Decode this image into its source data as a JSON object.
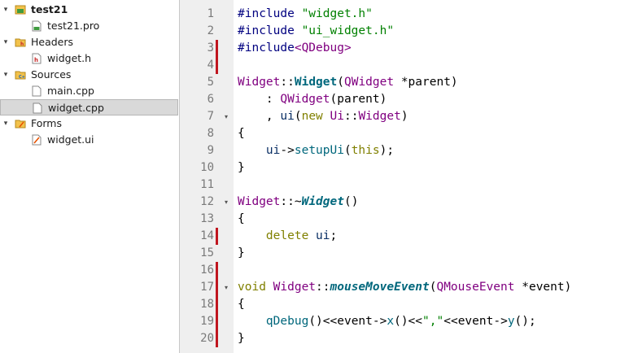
{
  "project_tree": [
    {
      "label": "test21",
      "depth": 0,
      "arrow": "down",
      "icon": "project-icon",
      "bold": true
    },
    {
      "label": "test21.pro",
      "depth": 1,
      "arrow": "",
      "icon": "pro-file-icon"
    },
    {
      "label": "Headers",
      "depth": 0,
      "arrow": "down",
      "icon": "headers-folder-icon"
    },
    {
      "label": "widget.h",
      "depth": 1,
      "arrow": "",
      "icon": "header-file-icon"
    },
    {
      "label": "Sources",
      "depth": 0,
      "arrow": "down",
      "icon": "sources-folder-icon"
    },
    {
      "label": "main.cpp",
      "depth": 1,
      "arrow": "",
      "icon": "cpp-file-icon"
    },
    {
      "label": "widget.cpp",
      "depth": 1,
      "arrow": "",
      "icon": "cpp-file-icon",
      "selected": true
    },
    {
      "label": "Forms",
      "depth": 0,
      "arrow": "down",
      "icon": "forms-folder-icon"
    },
    {
      "label": "widget.ui",
      "depth": 1,
      "arrow": "",
      "icon": "ui-file-icon"
    }
  ],
  "editor": {
    "lines": [
      {
        "n": "1",
        "changed": false,
        "fold": false,
        "tokens": [
          {
            "t": "#include ",
            "c": "pp"
          },
          {
            "t": "\"widget.h\"",
            "c": "str"
          }
        ]
      },
      {
        "n": "2",
        "changed": false,
        "fold": false,
        "tokens": [
          {
            "t": "#include ",
            "c": "pp"
          },
          {
            "t": "\"ui_widget.h\"",
            "c": "str"
          }
        ]
      },
      {
        "n": "3",
        "changed": true,
        "fold": false,
        "tokens": [
          {
            "t": "#include",
            "c": "pp"
          },
          {
            "t": "<QDebug>",
            "c": "type"
          }
        ]
      },
      {
        "n": "4",
        "changed": true,
        "fold": false,
        "tokens": []
      },
      {
        "n": "5",
        "changed": false,
        "fold": false,
        "tokens": [
          {
            "t": "Widget",
            "c": "type"
          },
          {
            "t": "::",
            "c": "pl"
          },
          {
            "t": "Widget",
            "c": "fnb"
          },
          {
            "t": "(",
            "c": "pl"
          },
          {
            "t": "QWidget",
            "c": "type"
          },
          {
            "t": " *parent)",
            "c": "pl"
          }
        ]
      },
      {
        "n": "6",
        "changed": false,
        "fold": false,
        "tokens": [
          {
            "t": "    : ",
            "c": "pl"
          },
          {
            "t": "QWidget",
            "c": "type"
          },
          {
            "t": "(parent)",
            "c": "pl"
          }
        ]
      },
      {
        "n": "7",
        "changed": false,
        "fold": true,
        "tokens": [
          {
            "t": "    , ",
            "c": "pl"
          },
          {
            "t": "ui",
            "c": "id"
          },
          {
            "t": "(",
            "c": "pl"
          },
          {
            "t": "new ",
            "c": "kw"
          },
          {
            "t": "Ui",
            "c": "type"
          },
          {
            "t": "::",
            "c": "pl"
          },
          {
            "t": "Widget",
            "c": "type"
          },
          {
            "t": ")",
            "c": "pl"
          }
        ]
      },
      {
        "n": "8",
        "changed": false,
        "fold": false,
        "tokens": [
          {
            "t": "{",
            "c": "pl"
          }
        ]
      },
      {
        "n": "9",
        "changed": false,
        "fold": false,
        "tokens": [
          {
            "t": "    ",
            "c": "pl"
          },
          {
            "t": "ui",
            "c": "id"
          },
          {
            "t": "->",
            "c": "pl"
          },
          {
            "t": "setupUi",
            "c": "fn"
          },
          {
            "t": "(",
            "c": "pl"
          },
          {
            "t": "this",
            "c": "kw"
          },
          {
            "t": ");",
            "c": "pl"
          }
        ]
      },
      {
        "n": "10",
        "changed": false,
        "fold": false,
        "tokens": [
          {
            "t": "}",
            "c": "pl"
          }
        ]
      },
      {
        "n": "11",
        "changed": false,
        "fold": false,
        "tokens": []
      },
      {
        "n": "12",
        "changed": false,
        "fold": true,
        "tokens": [
          {
            "t": "Widget",
            "c": "type"
          },
          {
            "t": "::~",
            "c": "pl"
          },
          {
            "t": "Widget",
            "c": "fni"
          },
          {
            "t": "()",
            "c": "pl"
          }
        ]
      },
      {
        "n": "13",
        "changed": false,
        "fold": false,
        "tokens": [
          {
            "t": "{",
            "c": "pl"
          }
        ]
      },
      {
        "n": "14",
        "changed": true,
        "fold": false,
        "tokens": [
          {
            "t": "    ",
            "c": "pl"
          },
          {
            "t": "delete ",
            "c": "kw"
          },
          {
            "t": "ui",
            "c": "id"
          },
          {
            "t": ";",
            "c": "pl"
          }
        ]
      },
      {
        "n": "15",
        "changed": false,
        "fold": false,
        "tokens": [
          {
            "t": "}",
            "c": "pl"
          }
        ]
      },
      {
        "n": "16",
        "changed": true,
        "fold": false,
        "tokens": []
      },
      {
        "n": "17",
        "changed": true,
        "fold": true,
        "tokens": [
          {
            "t": "void ",
            "c": "kw"
          },
          {
            "t": "Widget",
            "c": "type"
          },
          {
            "t": "::",
            "c": "pl"
          },
          {
            "t": "mouseMoveEvent",
            "c": "fni"
          },
          {
            "t": "(",
            "c": "pl"
          },
          {
            "t": "QMouseEvent",
            "c": "type"
          },
          {
            "t": " *event)",
            "c": "pl"
          }
        ]
      },
      {
        "n": "18",
        "changed": true,
        "fold": false,
        "tokens": [
          {
            "t": "{",
            "c": "pl"
          }
        ]
      },
      {
        "n": "19",
        "changed": true,
        "fold": false,
        "tokens": [
          {
            "t": "    ",
            "c": "pl"
          },
          {
            "t": "qDebug",
            "c": "fn"
          },
          {
            "t": "()<<",
            "c": "pl"
          },
          {
            "t": "event",
            "c": "pl"
          },
          {
            "t": "->",
            "c": "pl"
          },
          {
            "t": "x",
            "c": "fn"
          },
          {
            "t": "()<<",
            "c": "pl"
          },
          {
            "t": "\",\"",
            "c": "str"
          },
          {
            "t": "<<",
            "c": "pl"
          },
          {
            "t": "event",
            "c": "pl"
          },
          {
            "t": "->",
            "c": "pl"
          },
          {
            "t": "y",
            "c": "fn"
          },
          {
            "t": "();",
            "c": "pl"
          }
        ]
      },
      {
        "n": "20",
        "changed": true,
        "fold": false,
        "tokens": [
          {
            "t": "}",
            "c": "pl"
          }
        ]
      }
    ]
  },
  "colors": {
    "change_marker": "#c0161f",
    "gutter_bg": "#efefef",
    "selection_bg": "#d9d9d9"
  }
}
